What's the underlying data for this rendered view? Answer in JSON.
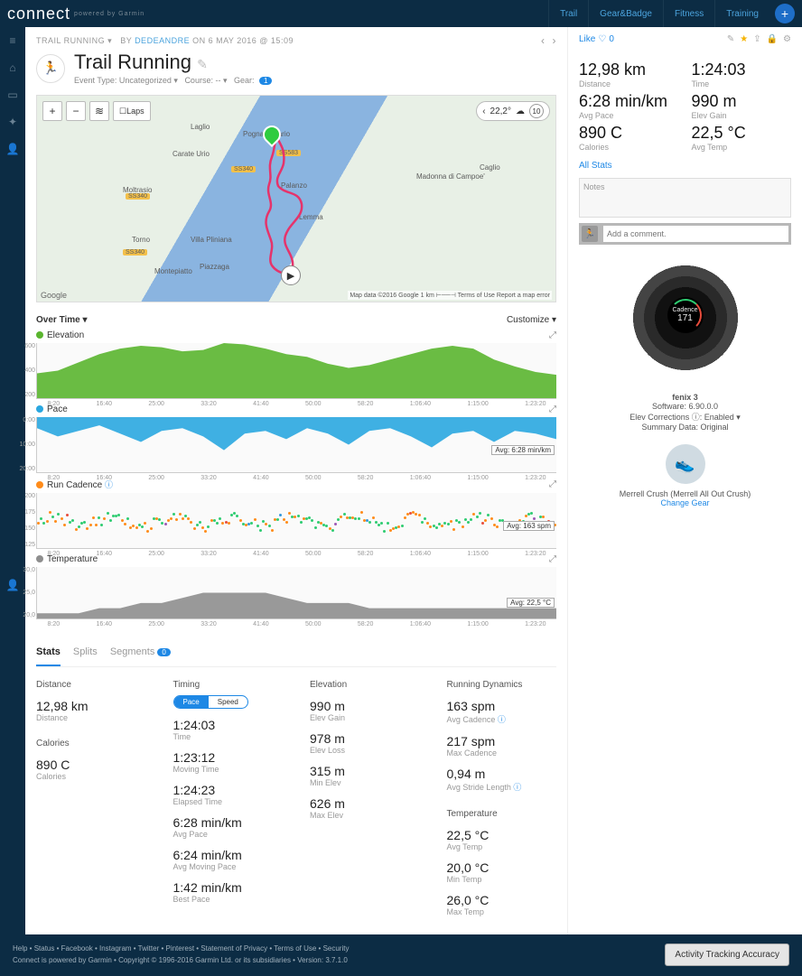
{
  "brand": {
    "name": "connect",
    "sub": "powered by Garmin"
  },
  "topnav": {
    "trail": "Trail",
    "gear": "Gear&Badge",
    "fitness": "Fitness",
    "training": "Training"
  },
  "breadcrumb": {
    "category": "TRAIL RUNNING",
    "by": "BY",
    "user": "DEDEANDRE",
    "on": "ON 6 MAY 2016 @ 15:09"
  },
  "title": "Trail Running",
  "subtitle": {
    "event": "Event Type: Uncategorized ▾",
    "course": "Course: -- ▾",
    "gear": "Gear:",
    "gear_count": "1"
  },
  "map": {
    "temp": "22,2°",
    "wind": "10",
    "laps_btn": "Laps",
    "attr": "Map data ©2016 Google   1 km ⊢──⊣   Terms of Use   Report a map error",
    "google": "Google",
    "labels": [
      "Laglio",
      "Carate Urio",
      "Pognana Lario",
      "Moltrasio",
      "Torno",
      "Villa Pliniana",
      "Piazzaga",
      "Montepiatto",
      "Palanzo",
      "Lemma",
      "Madonna di Campoe'",
      "Caglio"
    ],
    "roads": [
      "SS340",
      "SS340",
      "SS340",
      "SS583"
    ]
  },
  "chart_hdr": {
    "left": "Over Time ▾",
    "right": "Customize ▾"
  },
  "chart_data": [
    {
      "type": "area",
      "title": "Elevation",
      "color": "#5ab52f",
      "ylim": [
        200,
        600
      ],
      "yticks": [
        "600",
        "400",
        "200"
      ],
      "avg": null,
      "values": [
        380,
        400,
        460,
        520,
        560,
        580,
        570,
        540,
        550,
        600,
        590,
        560,
        520,
        500,
        450,
        420,
        440,
        480,
        520,
        560,
        580,
        560,
        480,
        430,
        390,
        370
      ]
    },
    {
      "type": "area",
      "title": "Pace",
      "color": "#2aa7e0",
      "ylim_rev": [
        0,
        20
      ],
      "yticks": [
        "0:00",
        "10:00",
        "20:00"
      ],
      "avg": "Avg: 6:28 min/km",
      "values": [
        4,
        7,
        5,
        3,
        6,
        9,
        5,
        4,
        7,
        12,
        6,
        5,
        8,
        4,
        6,
        10,
        5,
        4,
        7,
        11,
        6,
        5,
        9,
        5,
        6,
        8
      ]
    },
    {
      "type": "scatter",
      "title": "Run Cadence",
      "color": "#ff8c1a",
      "ylim": [
        125,
        200
      ],
      "yticks": [
        "200",
        "175",
        "150",
        "125"
      ],
      "avg": "Avg: 163 spm",
      "info": true
    },
    {
      "type": "area",
      "title": "Temperature",
      "color": "#8e8e8e",
      "ylim": [
        20,
        30
      ],
      "yticks": [
        "30,0",
        "25,0",
        "20,0"
      ],
      "avg": "Avg: 22,5 °C",
      "values": [
        21,
        21,
        21,
        22,
        22,
        23,
        23,
        24,
        25,
        25,
        25,
        25,
        24,
        23,
        23,
        23,
        22,
        22,
        22,
        22,
        22,
        22,
        22,
        22,
        22,
        22
      ]
    }
  ],
  "xticks": [
    "8:20",
    "16:40",
    "25:00",
    "33:20",
    "41:40",
    "50:00",
    "58:20",
    "1:06:40",
    "1:15:00",
    "1:23:20"
  ],
  "tabs": {
    "stats": "Stats",
    "splits": "Splits",
    "segments": "Segments",
    "seg_count": "0"
  },
  "stats": {
    "col1": {
      "title": "Distance",
      "items": [
        [
          "12,98 km",
          "Distance"
        ]
      ],
      "title2": "Calories",
      "items2": [
        [
          "890 C",
          "Calories"
        ]
      ]
    },
    "col2": {
      "title": "Timing",
      "toggle": [
        "Pace",
        "Speed"
      ],
      "items": [
        [
          "1:24:03",
          "Time"
        ],
        [
          "1:23:12",
          "Moving Time"
        ],
        [
          "1:24:23",
          "Elapsed Time"
        ],
        [
          "6:28 min/km",
          "Avg Pace"
        ],
        [
          "6:24 min/km",
          "Avg Moving Pace"
        ],
        [
          "1:42 min/km",
          "Best Pace"
        ]
      ]
    },
    "col3": {
      "title": "Elevation",
      "items": [
        [
          "990 m",
          "Elev Gain"
        ],
        [
          "978 m",
          "Elev Loss"
        ],
        [
          "315 m",
          "Min Elev"
        ],
        [
          "626 m",
          "Max Elev"
        ]
      ]
    },
    "col4": {
      "title": "Running Dynamics",
      "items": [
        [
          "163 spm",
          "Avg Cadence",
          true
        ],
        [
          "217 spm",
          "Max Cadence"
        ],
        [
          "0,94 m",
          "Avg Stride Length",
          true
        ]
      ],
      "title2": "Temperature",
      "items2": [
        [
          "22,5 °C",
          "Avg Temp"
        ],
        [
          "20,0 °C",
          "Min Temp"
        ],
        [
          "26,0 °C",
          "Max Temp"
        ]
      ]
    }
  },
  "right": {
    "like": "Like",
    "like_count": "0",
    "metrics": [
      [
        "12,98 km",
        "Distance"
      ],
      [
        "1:24:03",
        "Time"
      ],
      [
        "6:28 min/km",
        "Avg Pace"
      ],
      [
        "990 m",
        "Elev Gain"
      ],
      [
        "890 C",
        "Calories"
      ],
      [
        "22,5 °C",
        "Avg Temp"
      ]
    ],
    "all_stats": "All Stats",
    "notes_placeholder": "Notes",
    "comment_placeholder": "Add a comment.",
    "device": {
      "name": "fenix 3",
      "sw": "Software: 6.90.0.0",
      "elev": "Elev Corrections ⓘ: Enabled ▾",
      "sum": "Summary Data: Original",
      "face": "171"
    },
    "gear": {
      "name": "Merrell Crush (Merrell All Out Crush)",
      "change": "Change Gear"
    }
  },
  "footer": {
    "links": "Help  •  Status  •  Facebook  •  Instagram  •  Twitter  •  Pinterest  •  Statement of Privacy  •  Terms of Use  •  Security",
    "copy": "Connect is powered by Garmin • Copyright © 1996-2016 Garmin Ltd. or its subsidiaries • Version: 3.7.1.0",
    "btn": "Activity Tracking Accuracy"
  }
}
